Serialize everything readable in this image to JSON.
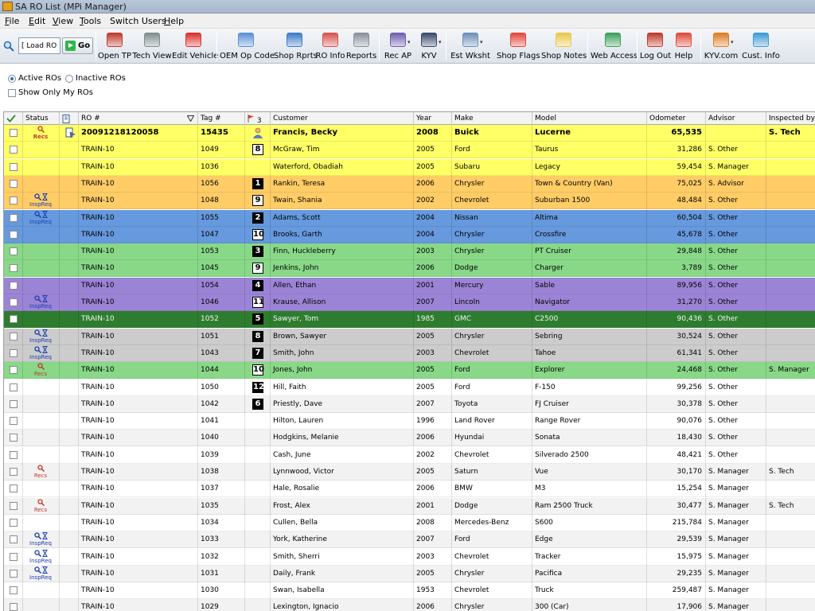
{
  "window": {
    "title": "SA RO List (MPi Manager)"
  },
  "menu": [
    {
      "label": "File",
      "ul": "F",
      "rest": "ile"
    },
    {
      "label": "Edit",
      "ul": "E",
      "rest": "dit"
    },
    {
      "label": "View",
      "ul": "V",
      "rest": "iew"
    },
    {
      "label": "Tools",
      "ul": "T",
      "rest": "ools"
    },
    {
      "label": "Switch Users",
      "ul": "",
      "rest": "Switch Users"
    },
    {
      "label": "Help",
      "ul": "H",
      "rest": "elp"
    }
  ],
  "toolbar": {
    "load_ro_value": "[ Load RO ]",
    "go_label": "Go",
    "buttons": [
      {
        "label": "Open TP",
        "icon": "open-tp-icon",
        "color": "#c0392b"
      },
      {
        "label": "Tech View",
        "icon": "tech-view-icon",
        "color": "#7f8c8d"
      },
      {
        "label": "Edit Vehicle",
        "icon": "edit-vehicle-icon",
        "color": "#d9302c"
      },
      {
        "label": "OEM Op Code",
        "icon": "oem-op-code-icon",
        "color": "#5b8fd6"
      },
      {
        "label": "Shop Rprts",
        "icon": "shop-reports-icon",
        "color": "#3d7cc9"
      },
      {
        "label": "RO Info",
        "icon": "ro-info-icon",
        "color": "#d9534f"
      },
      {
        "label": "Reports",
        "icon": "reports-icon",
        "color": "#8a9099"
      },
      {
        "label": "Rec AP",
        "icon": "rec-ap-icon",
        "color": "#6f5fb0"
      },
      {
        "label": "KYV",
        "icon": "kyv-icon",
        "color": "#3a4a6a"
      },
      {
        "label": "Est Wksht",
        "icon": "est-wksht-icon",
        "color": "#6d8fb8"
      },
      {
        "label": "Shop Flags",
        "icon": "shop-flags-icon",
        "color": "#e2463b"
      },
      {
        "label": "Shop Notes",
        "icon": "shop-notes-icon",
        "color": "#e8c74a"
      },
      {
        "label": "Web Access",
        "icon": "web-access-icon",
        "color": "#3ba05a"
      },
      {
        "label": "Log Out",
        "icon": "log-out-icon",
        "color": "#c0392b"
      },
      {
        "label": "Help",
        "icon": "help-icon",
        "color": "#e04a3a"
      },
      {
        "label": "KYV.com",
        "icon": "kyv-com-icon",
        "color": "#e07b22"
      },
      {
        "label": "Cust. Info",
        "icon": "cust-info-icon",
        "color": "#3f9ad6"
      }
    ]
  },
  "options": {
    "active_label": "Active ROs",
    "inactive_label": "Inactive ROs",
    "active_selected": true,
    "show_only_mine_label": "Show Only My ROs"
  },
  "grid": {
    "headers": {
      "status": "Status",
      "ro": "RO #",
      "tag": "Tag #",
      "flag_count": "3",
      "customer": "Customer",
      "year": "Year",
      "make": "Make",
      "model": "Model",
      "odometer": "Odometer",
      "advisor": "Advisor",
      "inspected_by": "Inspected by"
    },
    "colors": {
      "yellow": "#ffff66",
      "orange": "#ffcc66",
      "blue": "#6699dd",
      "green": "#88d888",
      "purple": "#9b84d6",
      "darkgreen": "#2e7d2e",
      "gray": "#cccccc",
      "white": "#ffffff",
      "light": "#f2f2f2"
    },
    "rows": [
      {
        "color": "yellow",
        "first": true,
        "status": "recs",
        "icon": "doc",
        "ro": "20091218120058",
        "tag": "1543S",
        "badge": "person",
        "customer": "Francis, Becky",
        "year": "2008",
        "make": "Buick",
        "model": "Lucerne",
        "odometer": "65,535",
        "advisor": "",
        "inspected_by": "S. Tech"
      },
      {
        "color": "yellow",
        "status": "",
        "ro": "TRAIN-10",
        "tag": "1049",
        "badge": "8",
        "badge_style": "light",
        "customer": "McGraw, Tim",
        "year": "2005",
        "make": "Ford",
        "model": "Taurus",
        "odometer": "31,286",
        "advisor": "S. Other",
        "inspected_by": ""
      },
      {
        "color": "yellow",
        "status": "",
        "ro": "TRAIN-10",
        "tag": "1036",
        "badge": "",
        "customer": "Waterford, Obadiah",
        "year": "2005",
        "make": "Subaru",
        "model": "Legacy",
        "odometer": "59,454",
        "advisor": "S. Manager",
        "inspected_by": ""
      },
      {
        "color": "orange",
        "status": "",
        "ro": "TRAIN-10",
        "tag": "1056",
        "badge": "1",
        "badge_style": "dark",
        "customer": "Rankin, Teresa",
        "year": "2006",
        "make": "Chrysler",
        "model": "Town & Country (Van)",
        "odometer": "75,025",
        "advisor": "S. Advisor",
        "inspected_by": ""
      },
      {
        "color": "orange",
        "status": "inspreq",
        "ro": "TRAIN-10",
        "tag": "1048",
        "badge": "9",
        "badge_style": "light",
        "customer": "Twain, Shania",
        "year": "2002",
        "make": "Chevrolet",
        "model": "Suburban 1500",
        "odometer": "48,484",
        "advisor": "S. Other",
        "inspected_by": ""
      },
      {
        "color": "blue",
        "status": "inspreq",
        "ro": "TRAIN-10",
        "tag": "1055",
        "badge": "2",
        "badge_style": "dark",
        "customer": "Adams, Scott",
        "year": "2004",
        "make": "Nissan",
        "model": "Altima",
        "odometer": "60,504",
        "advisor": "S. Other",
        "inspected_by": ""
      },
      {
        "color": "blue",
        "status": "",
        "ro": "TRAIN-10",
        "tag": "1047",
        "badge": "10",
        "badge_style": "light",
        "customer": "Brooks, Garth",
        "year": "2004",
        "make": "Chrysler",
        "model": "Crossfire",
        "odometer": "45,678",
        "advisor": "S. Other",
        "inspected_by": ""
      },
      {
        "color": "green",
        "status": "",
        "ro": "TRAIN-10",
        "tag": "1053",
        "badge": "3",
        "badge_style": "dark",
        "customer": "Finn, Huckleberry",
        "year": "2003",
        "make": "Chrysler",
        "model": "PT Cruiser",
        "odometer": "29,848",
        "advisor": "S. Other",
        "inspected_by": ""
      },
      {
        "color": "green",
        "status": "",
        "ro": "TRAIN-10",
        "tag": "1045",
        "badge": "9",
        "badge_style": "light",
        "customer": "Jenkins, John",
        "year": "2006",
        "make": "Dodge",
        "model": "Charger",
        "odometer": "3,789",
        "advisor": "S. Other",
        "inspected_by": ""
      },
      {
        "color": "purple",
        "status": "",
        "ro": "TRAIN-10",
        "tag": "1054",
        "badge": "4",
        "badge_style": "dark",
        "customer": "Allen, Ethan",
        "year": "2001",
        "make": "Mercury",
        "model": "Sable",
        "odometer": "89,956",
        "advisor": "S. Other",
        "inspected_by": ""
      },
      {
        "color": "purple",
        "status": "inspreq",
        "ro": "TRAIN-10",
        "tag": "1046",
        "badge": "11",
        "badge_style": "light",
        "customer": "Krause, Allison",
        "year": "2007",
        "make": "Lincoln",
        "model": "Navigator",
        "odometer": "31,270",
        "advisor": "S. Other",
        "inspected_by": ""
      },
      {
        "color": "darkgreen",
        "status": "",
        "ro": "TRAIN-10",
        "tag": "1052",
        "badge": "5",
        "badge_style": "dark",
        "customer": "Sawyer, Tom",
        "year": "1985",
        "make": "GMC",
        "model": "C2500",
        "odometer": "90,436",
        "advisor": "S. Other",
        "inspected_by": ""
      },
      {
        "color": "gray",
        "status": "inspreq",
        "ro": "TRAIN-10",
        "tag": "1051",
        "badge": "8",
        "badge_style": "dark",
        "customer": "Brown, Sawyer",
        "year": "2005",
        "make": "Chrysler",
        "model": "Sebring",
        "odometer": "30,524",
        "advisor": "S. Other",
        "inspected_by": ""
      },
      {
        "color": "gray",
        "status": "inspreq",
        "ro": "TRAIN-10",
        "tag": "1043",
        "badge": "7",
        "badge_style": "dark",
        "customer": "Smith, John",
        "year": "2003",
        "make": "Chevrolet",
        "model": "Tahoe",
        "odometer": "61,341",
        "advisor": "S. Other",
        "inspected_by": ""
      },
      {
        "color": "green",
        "status": "recs",
        "ro": "TRAIN-10",
        "tag": "1044",
        "badge": "10",
        "badge_style": "light",
        "customer": "Jones, John",
        "year": "2005",
        "make": "Ford",
        "model": "Explorer",
        "odometer": "24,468",
        "advisor": "S. Other",
        "inspected_by": "S. Manager"
      },
      {
        "color": "white",
        "status": "",
        "ro": "TRAIN-10",
        "tag": "1050",
        "badge": "12",
        "badge_style": "dark",
        "customer": "Hill, Faith",
        "year": "2005",
        "make": "Ford",
        "model": "F-150",
        "odometer": "99,256",
        "advisor": "S. Other",
        "inspected_by": ""
      },
      {
        "color": "light",
        "status": "",
        "ro": "TRAIN-10",
        "tag": "1042",
        "badge": "6",
        "badge_style": "dark",
        "customer": "Priestly, Dave",
        "year": "2007",
        "make": "Toyota",
        "model": "FJ Cruiser",
        "odometer": "30,378",
        "advisor": "S. Other",
        "inspected_by": ""
      },
      {
        "color": "white",
        "status": "",
        "ro": "TRAIN-10",
        "tag": "1041",
        "badge": "",
        "customer": "Hilton, Lauren",
        "year": "1996",
        "make": "Land Rover",
        "model": "Range Rover",
        "odometer": "90,076",
        "advisor": "S. Other",
        "inspected_by": ""
      },
      {
        "color": "light",
        "status": "",
        "ro": "TRAIN-10",
        "tag": "1040",
        "badge": "",
        "customer": "Hodgkins, Melanie",
        "year": "2006",
        "make": "Hyundai",
        "model": "Sonata",
        "odometer": "18,430",
        "advisor": "S. Other",
        "inspected_by": ""
      },
      {
        "color": "white",
        "status": "",
        "ro": "TRAIN-10",
        "tag": "1039",
        "badge": "",
        "customer": "Cash, June",
        "year": "2002",
        "make": "Chevrolet",
        "model": "Silverado 2500",
        "odometer": "48,421",
        "advisor": "S. Other",
        "inspected_by": ""
      },
      {
        "color": "light",
        "status": "recs",
        "ro": "TRAIN-10",
        "tag": "1038",
        "badge": "",
        "customer": "Lynnwood, Victor",
        "year": "2005",
        "make": "Saturn",
        "model": "Vue",
        "odometer": "30,170",
        "advisor": "S. Manager",
        "inspected_by": "S. Tech"
      },
      {
        "color": "white",
        "status": "",
        "ro": "TRAIN-10",
        "tag": "1037",
        "badge": "",
        "customer": "Hale, Rosalie",
        "year": "2006",
        "make": "BMW",
        "model": "M3",
        "odometer": "15,254",
        "advisor": "S. Manager",
        "inspected_by": ""
      },
      {
        "color": "light",
        "status": "recs",
        "ro": "TRAIN-10",
        "tag": "1035",
        "badge": "",
        "customer": "Frost, Alex",
        "year": "2001",
        "make": "Dodge",
        "model": "Ram 2500 Truck",
        "odometer": "30,477",
        "advisor": "S. Manager",
        "inspected_by": "S. Tech"
      },
      {
        "color": "white",
        "status": "",
        "ro": "TRAIN-10",
        "tag": "1034",
        "badge": "",
        "customer": "Cullen, Bella",
        "year": "2008",
        "make": "Mercedes-Benz",
        "model": "S600",
        "odometer": "215,784",
        "advisor": "S. Manager",
        "inspected_by": ""
      },
      {
        "color": "light",
        "status": "inspreq",
        "ro": "TRAIN-10",
        "tag": "1033",
        "badge": "",
        "customer": "York, Katherine",
        "year": "2007",
        "make": "Ford",
        "model": "Edge",
        "odometer": "29,539",
        "advisor": "S. Manager",
        "inspected_by": ""
      },
      {
        "color": "white",
        "status": "inspreq",
        "ro": "TRAIN-10",
        "tag": "1032",
        "badge": "",
        "customer": "Smith, Sherri",
        "year": "2003",
        "make": "Chevrolet",
        "model": "Tracker",
        "odometer": "15,975",
        "advisor": "S. Manager",
        "inspected_by": ""
      },
      {
        "color": "light",
        "status": "inspreq",
        "ro": "TRAIN-10",
        "tag": "1031",
        "badge": "",
        "customer": "Daily, Frank",
        "year": "2005",
        "make": "Chrysler",
        "model": "Pacifica",
        "odometer": "29,235",
        "advisor": "S. Manager",
        "inspected_by": ""
      },
      {
        "color": "white",
        "status": "",
        "ro": "TRAIN-10",
        "tag": "1030",
        "badge": "",
        "customer": "Swan, Isabella",
        "year": "1953",
        "make": "Chevrolet",
        "model": "Truck",
        "odometer": "259,487",
        "advisor": "S. Manager",
        "inspected_by": ""
      },
      {
        "color": "light",
        "status": "",
        "ro": "TRAIN-10",
        "tag": "1029",
        "badge": "",
        "customer": "Lexington, Ignacio",
        "year": "2006",
        "make": "Chrysler",
        "model": "300 (Car)",
        "odometer": "17,906",
        "advisor": "S. Manager",
        "inspected_by": ""
      }
    ],
    "status_labels": {
      "recs": "Recs",
      "inspreq": "InspReq"
    }
  }
}
